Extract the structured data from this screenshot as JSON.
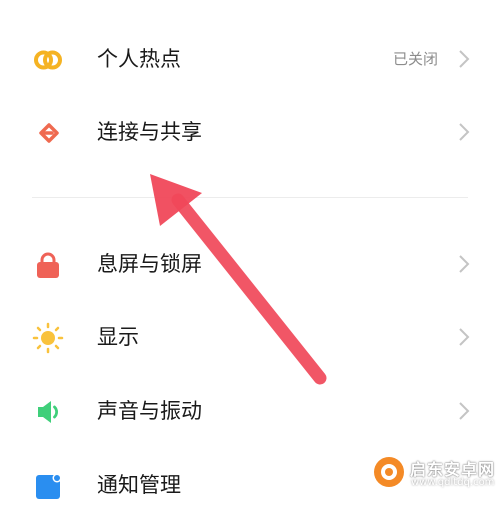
{
  "settings": {
    "items": [
      {
        "label": "个人热点",
        "status": "已关闭",
        "icon": "hotspot-icon"
      },
      {
        "label": "连接与共享",
        "icon": "connection-share-icon"
      },
      {
        "label": "息屏与锁屏",
        "icon": "lock-icon"
      },
      {
        "label": "显示",
        "icon": "sun-icon"
      },
      {
        "label": "声音与振动",
        "icon": "speaker-icon"
      },
      {
        "label": "通知管理",
        "icon": "notification-icon"
      }
    ]
  },
  "watermark": {
    "name": "启东安卓网",
    "url": "www.qdltdq.com"
  },
  "colors": {
    "hotspot": "#f5b323",
    "connection": "#ef6a50",
    "lock": "#ef6257",
    "sun": "#f9c23c",
    "speaker": "#3fcf7a",
    "notification": "#2a8ef0",
    "arrow": "#f0485a",
    "chevron": "#c4c4c4"
  }
}
